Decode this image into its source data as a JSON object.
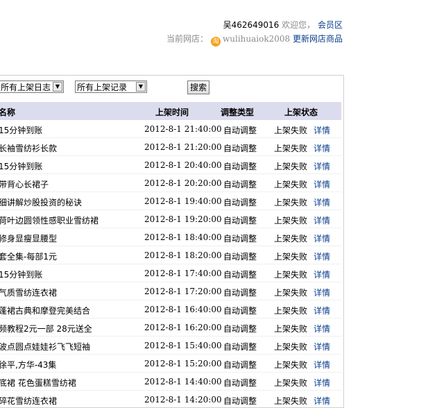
{
  "top": {
    "username": "吴462649016",
    "welcome": "欢迎您，",
    "member_zone": "会员区",
    "current_store_label": "当前网店：",
    "store_icon": "淘",
    "store_name": "wulihuaiok2008",
    "update_link": "更新网店商品"
  },
  "filters": {
    "log_select": "所有上架日志",
    "record_select": "所有上架记录",
    "search_button": "搜索"
  },
  "table": {
    "headers": {
      "name": "名称",
      "time": "上架时间",
      "type": "调整类型",
      "status": "上架状态"
    },
    "rows": [
      {
        "name": "15分钟到账",
        "time": "2012-8-1 21:40:00",
        "type": "自动调整",
        "status": "上架失败",
        "detail": "详情"
      },
      {
        "name": "长袖雪纺衫长款",
        "time": "2012-8-1 21:20:00",
        "type": "自动调整",
        "status": "上架失败",
        "detail": "详情"
      },
      {
        "name": "15分钟到账",
        "time": "2012-8-1 20:40:00",
        "type": "自动调整",
        "status": "上架失败",
        "detail": "详情"
      },
      {
        "name": "带背心长裙子",
        "time": "2012-8-1 20:20:00",
        "type": "自动调整",
        "status": "上架失败",
        "detail": "详情"
      },
      {
        "name": "细讲解炒股投资的秘诀",
        "time": "2012-8-1 19:40:00",
        "type": "自动调整",
        "status": "上架失败",
        "detail": "详情"
      },
      {
        "name": "荷叶边圆领性感职业雪纺裙",
        "time": "2012-8-1 19:20:00",
        "type": "自动调整",
        "status": "上架失败",
        "detail": "详情"
      },
      {
        "name": "修身显瘦显腰型",
        "time": "2012-8-1 18:40:00",
        "type": "自动调整",
        "status": "上架失败",
        "detail": "详情"
      },
      {
        "name": "套全集-每部1元",
        "time": "2012-8-1 18:20:00",
        "type": "自动调整",
        "status": "上架失败",
        "detail": "详情"
      },
      {
        "name": "15分钟到账",
        "time": "2012-8-1 17:40:00",
        "type": "自动调整",
        "status": "上架失败",
        "detail": "详情"
      },
      {
        "name": "气质雪纺连衣裙",
        "time": "2012-8-1 17:20:00",
        "type": "自动调整",
        "status": "上架失败",
        "detail": "详情"
      },
      {
        "name": "蓬裙古典和摩登完美结合",
        "time": "2012-8-1 16:40:00",
        "type": "自动调整",
        "status": "上架失败",
        "detail": "详情"
      },
      {
        "name": "频教程2元一部 28元送全",
        "time": "2012-8-1 16:20:00",
        "type": "自动调整",
        "status": "上架失败",
        "detail": "详情"
      },
      {
        "name": "波点圆点娃娃衫飞飞短袖",
        "time": "2012-8-1 15:40:00",
        "type": "自动调整",
        "status": "上架失败",
        "detail": "详情"
      },
      {
        "name": "徐平,方华-43集",
        "time": "2012-8-1 15:20:00",
        "type": "自动调整",
        "status": "上架失败",
        "detail": "详情"
      },
      {
        "name": "底裙 花色蛋糕雪纺裙",
        "time": "2012-8-1 14:40:00",
        "type": "自动调整",
        "status": "上架失败",
        "detail": "详情"
      },
      {
        "name": "碎花雪纺连衣裙",
        "time": "2012-8-1 14:20:00",
        "type": "自动调整",
        "status": "上架失败",
        "detail": "详情"
      }
    ]
  }
}
